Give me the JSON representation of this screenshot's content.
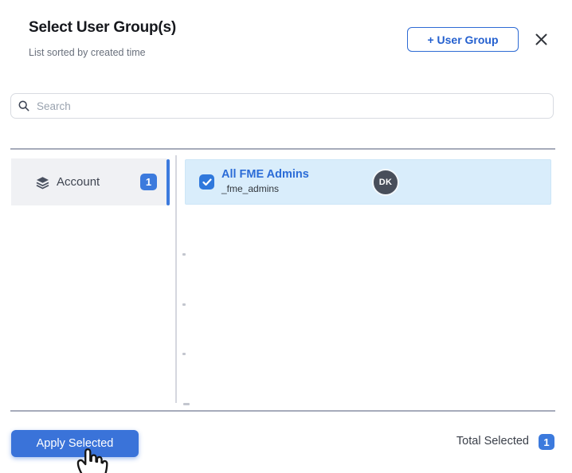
{
  "header": {
    "title": "Select User Group(s)",
    "subtitle": "List sorted by created time",
    "add_button_label": "+ User Group"
  },
  "search": {
    "placeholder": "Search",
    "value": ""
  },
  "sidebar": {
    "items": [
      {
        "label": "Account",
        "count": "1",
        "icon": "layers-icon",
        "active": true
      }
    ]
  },
  "list": {
    "items": [
      {
        "name": "All FME Admins",
        "code": "_fme_admins",
        "avatar_initials": "DK",
        "checked": true
      }
    ]
  },
  "footer": {
    "apply_label": "Apply Selected",
    "total_label": "Total Selected",
    "total_count": "1"
  },
  "colors": {
    "accent_blue": "#2f6fd9",
    "badge_blue": "#3c7add",
    "selected_row_bg": "#d9edfb",
    "sidebar_item_bg": "#f0f1f4",
    "avatar_bg": "#484e5a"
  }
}
